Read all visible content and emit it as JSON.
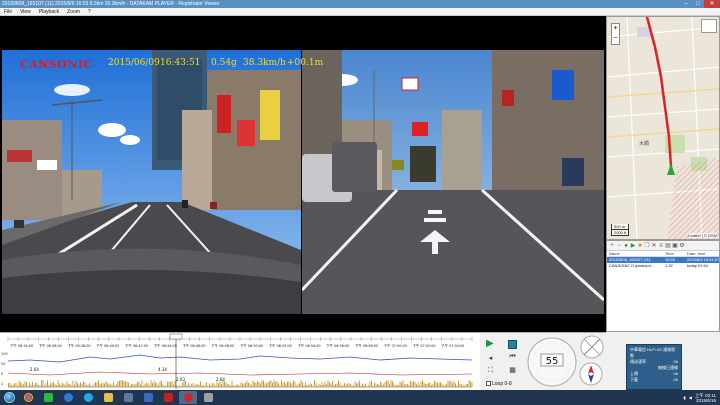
{
  "window": {
    "title": "20150609_165107 (11)    2015/6/9 16:53    8.3km    20.3km/h - DATAKAM PLAYER - Registrator Viewer",
    "buttons": {
      "minimize": "–",
      "maximize": "□",
      "close": "✕"
    }
  },
  "menu": [
    "File",
    "View",
    "Playback",
    "Zoom",
    "?"
  ],
  "hud": {
    "brand": "CANSONIC",
    "date": "2015/06/09",
    "time": "16:43:51",
    "g_force": "0.54g",
    "speed": "38.3km/h",
    "altitude": "+00.1m"
  },
  "map": {
    "zoom_in": "+",
    "zoom_out": "−",
    "scale_m": "500 m",
    "scale_ft": "2000 ft",
    "attribution": "Leaflet | © OSM",
    "place_label": "大順"
  },
  "file_list": {
    "headers": {
      "name": "Name",
      "time": "Time",
      "date": "Date, time"
    },
    "rows": [
      {
        "name": "20150609_165107 (11)",
        "time": "10:00",
        "date": "2015/6/9 16:51:07",
        "selected": true
      },
      {
        "name": "CANSONIC D-ipadmp4...",
        "time": "1:32",
        "date": "today 01:54",
        "selected": false
      }
    ]
  },
  "graph": {
    "upper_labels": [
      "下午 06:34:00",
      "下午 06:36:00",
      "下午 06:38:00",
      "下午 06:40:00",
      "下午 06:42:00",
      "下午 06:44:00",
      "下午 06:46:00",
      "下午 06:48:00",
      "下午 06:50:00",
      "下午 06:52:00",
      "下午 06:54:00",
      "下午 06:56:00",
      "下午 06:58:00",
      "下午 07:00:00",
      "下午 07:02:00",
      "下午 07:04:00"
    ],
    "speed_values": [
      "2.64",
      "4.34",
      "2.03",
      "2.64"
    ],
    "scale_values": [
      "100",
      "50",
      "0",
      "2"
    ]
  },
  "controls": {
    "play": "▶",
    "loop_label": "Loop 0-8",
    "speed_value": "55"
  },
  "popup": {
    "title": "中華電信 Hi-Fi 4G 連線狀態",
    "lines": [
      {
        "k": "傳送速率",
        "v": "0b"
      },
      {
        "k": "上傳",
        "v": "0b"
      },
      {
        "k": "下載",
        "v": "0b"
      }
    ],
    "status": "無線已連線"
  },
  "taskbar": {
    "time": "上午 02:11",
    "date": "2015/6/16"
  },
  "colors": {
    "hud_brand": "#d62020",
    "hud_text": "#f0e020",
    "route": "#e02020",
    "taskbar": "#1f3550",
    "selection": "#3a78d0"
  }
}
